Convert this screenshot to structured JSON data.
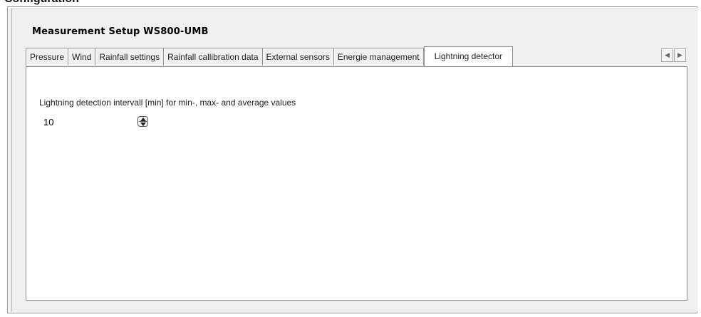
{
  "window": {
    "partial_title": "Configuration"
  },
  "form": {
    "title": "Measurement Setup  WS800-UMB"
  },
  "tabs": [
    {
      "label": "Pressure",
      "active": false
    },
    {
      "label": "Wind",
      "active": false
    },
    {
      "label": "Rainfall settings",
      "active": false
    },
    {
      "label": "Rainfall callibration data",
      "active": false
    },
    {
      "label": "External sensors",
      "active": false
    },
    {
      "label": "Energie management",
      "active": false
    },
    {
      "label": "Lightning detector",
      "active": true
    }
  ],
  "tab_scroll": {
    "left_icon": "arrow-left-icon",
    "right_icon": "arrow-right-icon"
  },
  "lightning": {
    "interval_label": "Lightning detection intervall [min] for min-, max- and average values",
    "interval_value": "10"
  }
}
